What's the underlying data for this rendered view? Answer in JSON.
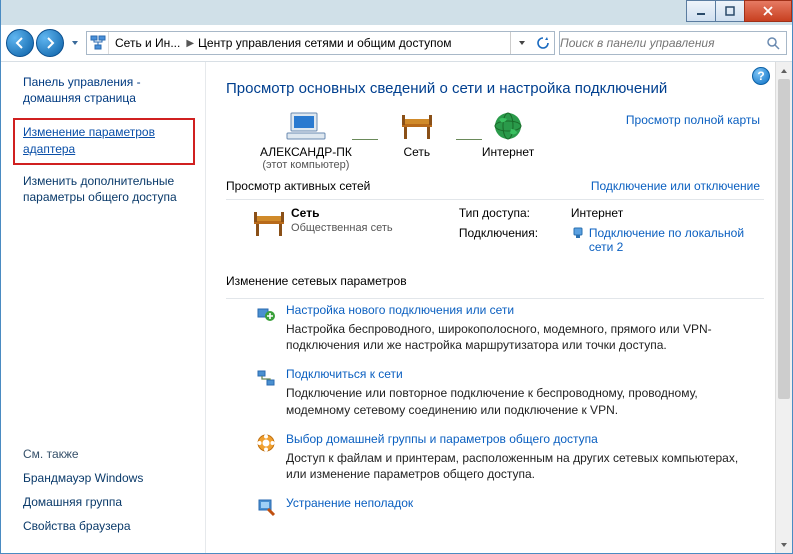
{
  "titlebar": {
    "min": "minimize",
    "max": "maximize",
    "close": "close"
  },
  "nav": {
    "breadcrumb1": "Сеть и Ин...",
    "breadcrumb2": "Центр управления сетями и общим доступом",
    "search_placeholder": "Поиск в панели управления"
  },
  "sidebar": {
    "home": "Панель управления - домашняя страница",
    "adapter_link": "Изменение параметров адаптера",
    "sharing_link": "Изменить дополнительные параметры общего доступа",
    "see_also_header": "См. также",
    "see_also": [
      "Брандмауэр Windows",
      "Домашняя группа",
      "Свойства браузера"
    ]
  },
  "main": {
    "title": "Просмотр основных сведений о сети и настройка подключений",
    "overview": {
      "pc_name": "АЛЕКСАНДР-ПК",
      "pc_sub": "(этот компьютер)",
      "net_name": "Сеть",
      "internet_name": "Интернет",
      "fullmap_link": "Просмотр полной карты"
    },
    "active_nets": {
      "label": "Просмотр активных сетей",
      "toggle_link": "Подключение или отключение",
      "conn_name": "Сеть",
      "conn_type": "Общественная сеть",
      "access_key": "Тип доступа:",
      "access_val": "Интернет",
      "conns_key": "Подключения:",
      "conns_val": "Подключение по локальной сети 2"
    },
    "change_header": "Изменение сетевых параметров",
    "tasks": [
      {
        "title": "Настройка нового подключения или сети",
        "desc": "Настройка беспроводного, широкополосного, модемного, прямого или VPN-подключения или же настройка маршрутизатора или точки доступа."
      },
      {
        "title": "Подключиться к сети",
        "desc": "Подключение или повторное подключение к беспроводному, проводному, модемному сетевому соединению или подключение к VPN."
      },
      {
        "title": "Выбор домашней группы и параметров общего доступа",
        "desc": "Доступ к файлам и принтерам, расположенным на других сетевых компьютерах, или изменение параметров общего доступа."
      },
      {
        "title": "Устранение неполадок",
        "desc": ""
      }
    ]
  }
}
